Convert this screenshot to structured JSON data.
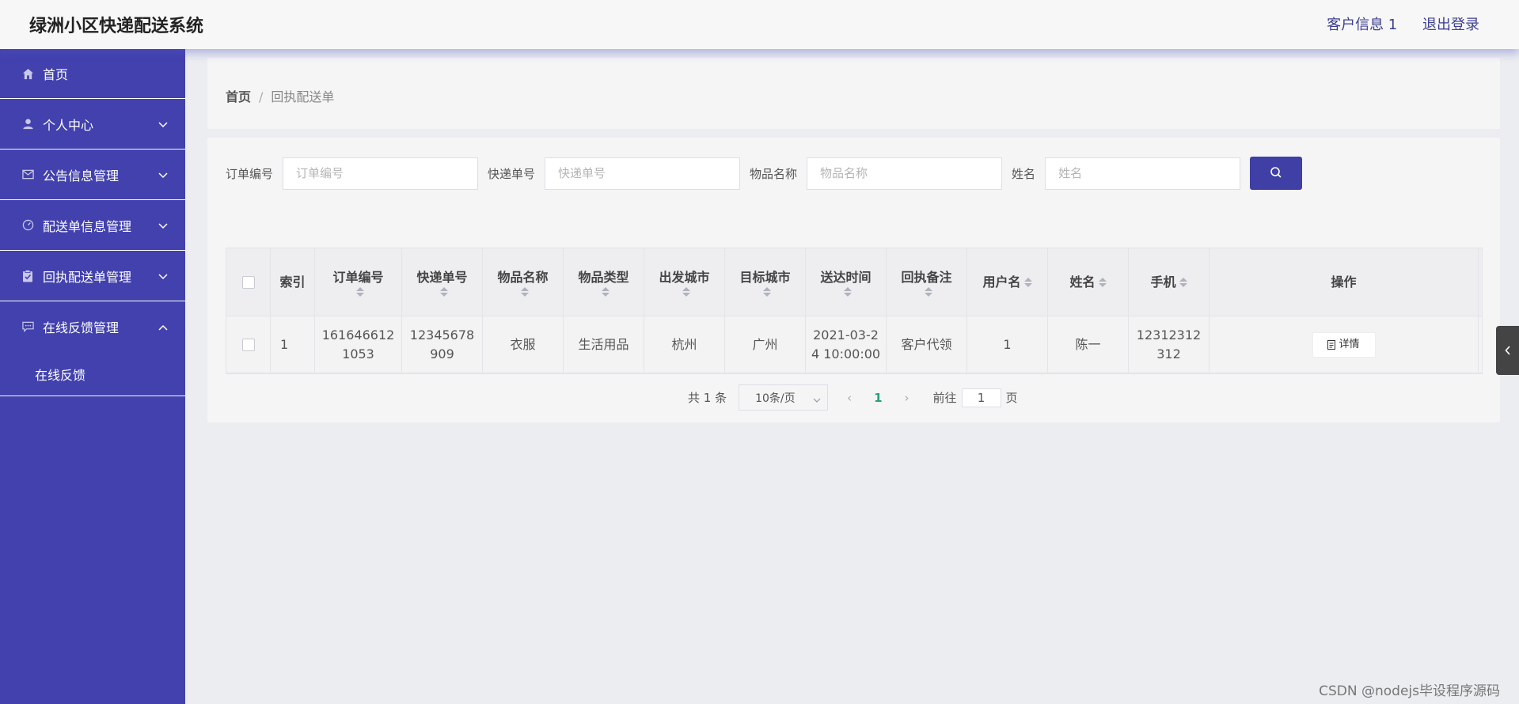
{
  "header": {
    "title": "绿洲小区快递配送系统",
    "customer_info": "客户信息 1",
    "logout": "退出登录"
  },
  "sidebar": {
    "items": [
      {
        "label": "首页",
        "icon": "home-icon"
      },
      {
        "label": "个人中心",
        "icon": "user-icon"
      },
      {
        "label": "公告信息管理",
        "icon": "mail-icon"
      },
      {
        "label": "配送单信息管理",
        "icon": "gauge-icon"
      },
      {
        "label": "回执配送单管理",
        "icon": "clipboard-icon"
      },
      {
        "label": "在线反馈管理",
        "icon": "chat-icon"
      }
    ],
    "submenu": [
      "在线反馈"
    ]
  },
  "breadcrumb": {
    "home": "首页",
    "current": "回执配送单"
  },
  "search": {
    "fields": [
      {
        "label": "订单编号",
        "placeholder": "订单编号"
      },
      {
        "label": "快递单号",
        "placeholder": "快递单号"
      },
      {
        "label": "物品名称",
        "placeholder": "物品名称"
      },
      {
        "label": "姓名",
        "placeholder": "姓名"
      }
    ]
  },
  "table": {
    "columns": [
      "索引",
      "订单编号",
      "快递单号",
      "物品名称",
      "物品类型",
      "出发城市",
      "目标城市",
      "送达时间",
      "回执备注",
      "用户名",
      "姓名",
      "手机",
      "操作"
    ],
    "rows": [
      {
        "index": "1",
        "order_no_1": "161646612",
        "order_no_2": "1053",
        "express_no_1": "12345678",
        "express_no_2": "909",
        "item_name": "衣服",
        "item_type": "生活用品",
        "from_city": "杭州",
        "to_city": "广州",
        "time_1": "2021-03-2",
        "time_2": "4 10:00:00",
        "remark": "客户代领",
        "username": "1",
        "name": "陈一",
        "phone_1": "12312312",
        "phone_2": "312",
        "action": "详情"
      }
    ]
  },
  "pagination": {
    "total": "共 1 条",
    "page_size": "10条/页",
    "current": "1",
    "goto_label": "前往",
    "goto_value": "1",
    "page_suffix": "页"
  },
  "watermark": "CSDN @nodejs毕设程序源码",
  "colors": {
    "sidebar": "#4241ad",
    "primary_button": "#3f3fa6",
    "accent_page": "#2aa07a"
  }
}
